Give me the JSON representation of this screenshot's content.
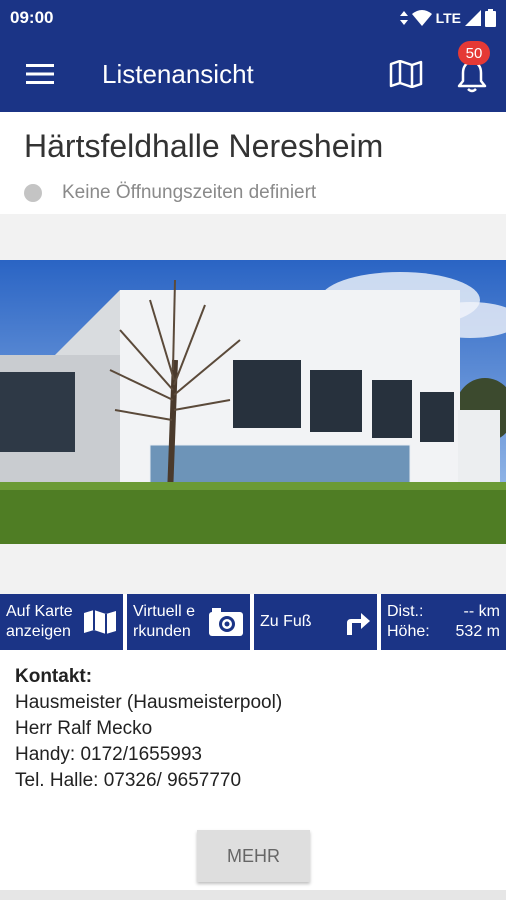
{
  "status_bar": {
    "time": "09:00",
    "network": "LTE"
  },
  "app_bar": {
    "title": "Listenansicht",
    "notification_count": "50",
    "icons": {
      "menu": "hamburger-icon",
      "map": "map-icon",
      "notifications": "bell-icon"
    }
  },
  "place": {
    "title": "Härtsfeldhalle Neresheim",
    "opening_hours": "Keine Öffnungszeiten definiert"
  },
  "actions": {
    "map_label": "Auf Karte anzeigen",
    "virtual_label": "Virtuell e rkunden",
    "walk_label": "Zu Fuß",
    "dist_label": "Dist.:",
    "dist_value": "-- km",
    "height_label": "Höhe:",
    "height_value": "532 m"
  },
  "contact": {
    "heading": "Kontakt:",
    "lines": [
      "Hausmeister (Hausmeisterpool)",
      "Herr Ralf Mecko",
      "Handy: 0172/1655993",
      "Tel. Halle:  07326/ 9657770"
    ]
  },
  "more_button": "MEHR",
  "colors": {
    "primary": "#1b3486",
    "badge": "#e53935",
    "button_grey": "#dedede"
  }
}
